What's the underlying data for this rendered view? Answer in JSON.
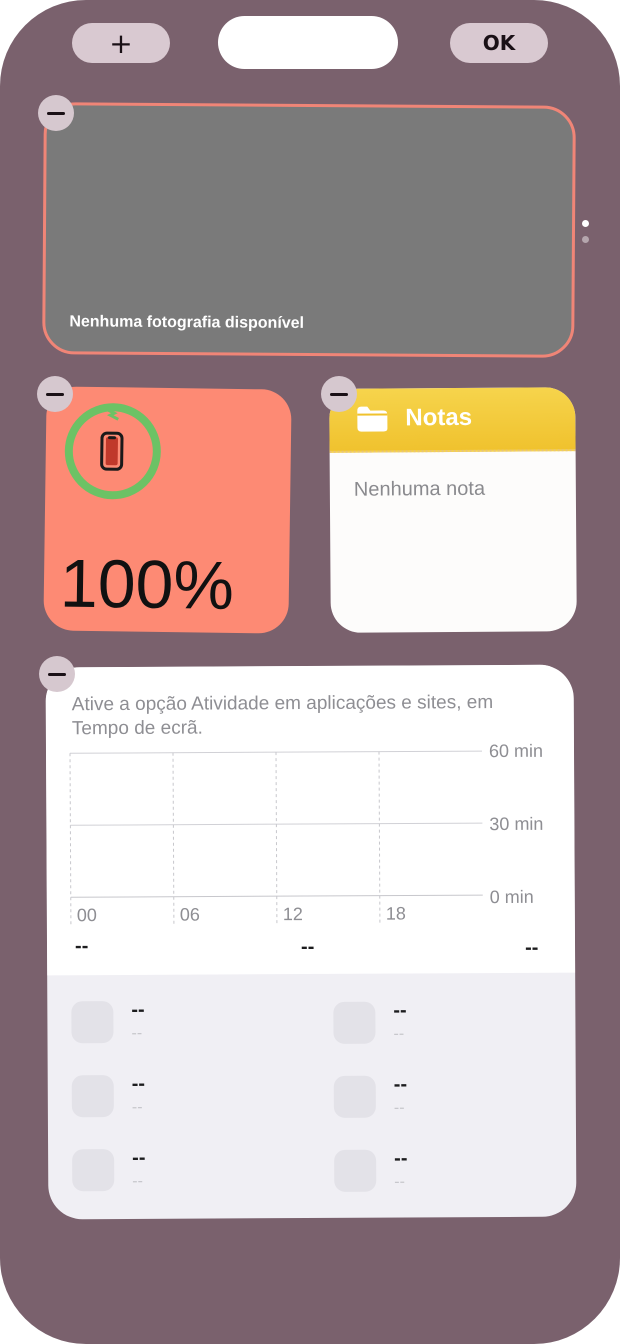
{
  "topbar": {
    "add_label": "+",
    "done_label": "OK"
  },
  "photos_widget": {
    "empty_text": "Nenhuma fotografia disponível"
  },
  "battery_widget": {
    "percent_text": "100%",
    "charge_level": 1.0,
    "ring_color": "#6cc265",
    "background_color": "#fd8a74"
  },
  "notes_widget": {
    "title": "Notas",
    "empty_text": "Nenhuma nota",
    "header_color": "#f3cb3a"
  },
  "screen_time_widget": {
    "message": "Ative a opção Atividade em aplicações e sites, em Tempo de ecrã.",
    "chart_data": {
      "type": "bar",
      "categories": [
        "00",
        "06",
        "12",
        "18"
      ],
      "y_ticks": [
        "60 min",
        "30 min",
        "0 min"
      ],
      "ylim": [
        0,
        60
      ],
      "series": [],
      "grid": true
    },
    "summary": [
      "--",
      "--",
      "--"
    ],
    "apps": [
      {
        "name": "--",
        "time": "--"
      },
      {
        "name": "--",
        "time": "--"
      },
      {
        "name": "--",
        "time": "--"
      },
      {
        "name": "--",
        "time": "--"
      },
      {
        "name": "--",
        "time": "--"
      },
      {
        "name": "--",
        "time": "--"
      }
    ]
  },
  "colors": {
    "wallpaper": "#7a616d",
    "remove_badge": "#d6c8cf"
  }
}
